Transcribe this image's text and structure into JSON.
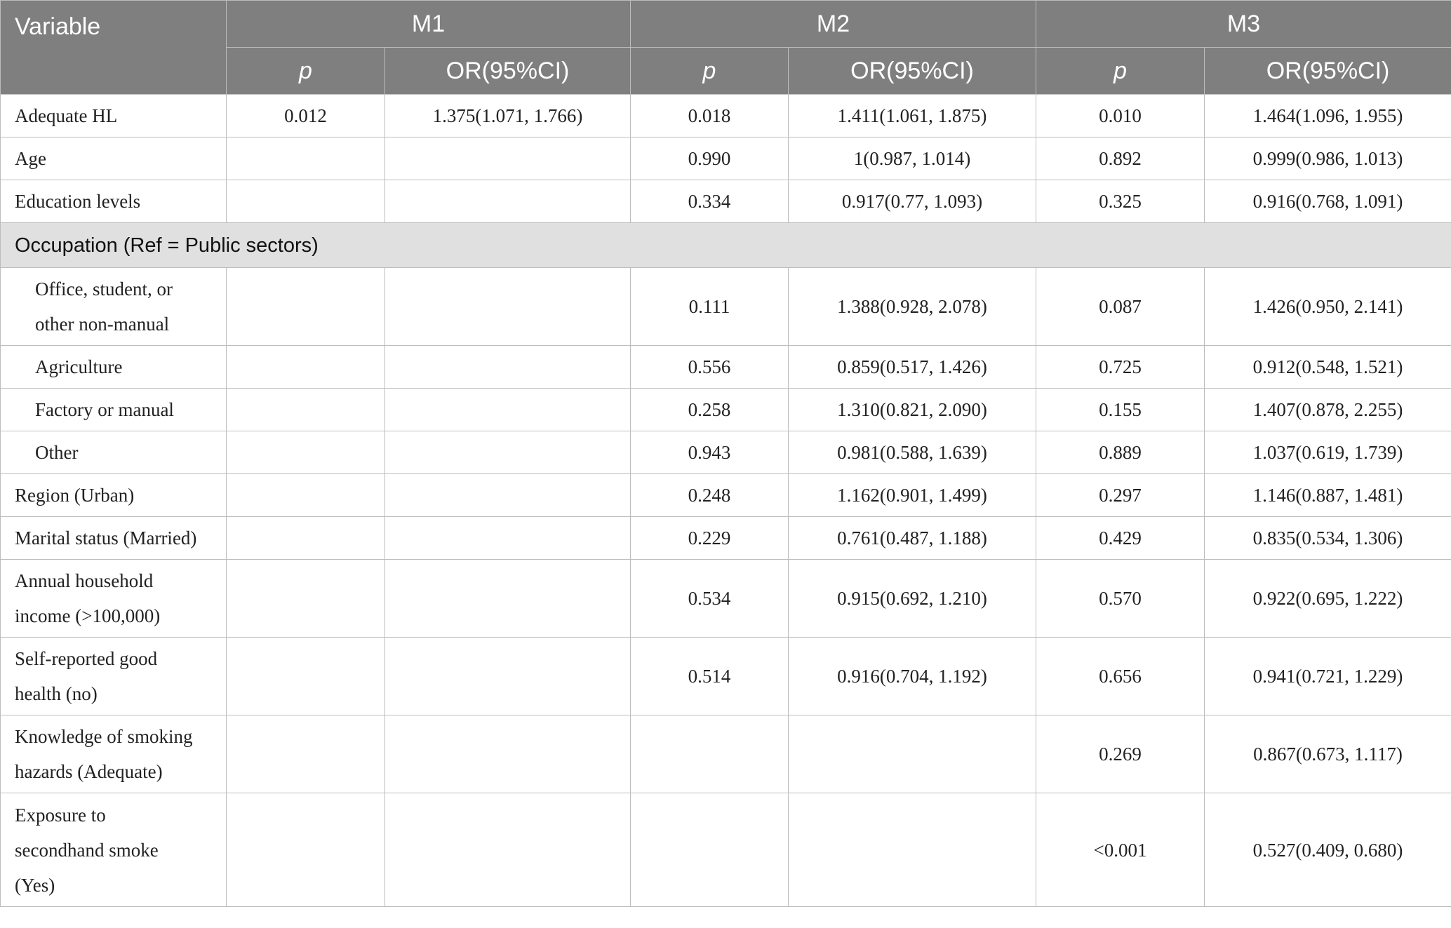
{
  "header": {
    "variable": "Variable",
    "models": [
      "M1",
      "M2",
      "M3"
    ],
    "p": "p",
    "or": "OR(95%CI)"
  },
  "section_label": "Occupation (Ref = Public sectors)",
  "rows_before": [
    {
      "label": "Adequate HL",
      "m1_p": "0.012",
      "m1_or": "1.375(1.071, 1.766)",
      "m2_p": "0.018",
      "m2_or": "1.411(1.061, 1.875)",
      "m3_p": "0.010",
      "m3_or": "1.464(1.096, 1.955)"
    },
    {
      "label": "Age",
      "m1_p": "",
      "m1_or": "",
      "m2_p": "0.990",
      "m2_or": "1(0.987, 1.014)",
      "m3_p": "0.892",
      "m3_or": "0.999(0.986, 1.013)"
    },
    {
      "label": "Education levels",
      "m1_p": "",
      "m1_or": "",
      "m2_p": "0.334",
      "m2_or": "0.917(0.77, 1.093)",
      "m3_p": "0.325",
      "m3_or": "0.916(0.768, 1.091)"
    }
  ],
  "occupation_rows": [
    {
      "label_line1": "Office, student, or",
      "label_line2": "other non-manual",
      "m2_p": "0.111",
      "m2_or": "1.388(0.928, 2.078)",
      "m3_p": "0.087",
      "m3_or": "1.426(0.950, 2.141)"
    },
    {
      "label": "Agriculture",
      "m2_p": "0.556",
      "m2_or": "0.859(0.517, 1.426)",
      "m3_p": "0.725",
      "m3_or": "0.912(0.548, 1.521)"
    },
    {
      "label": "Factory or manual",
      "m2_p": "0.258",
      "m2_or": "1.310(0.821, 2.090)",
      "m3_p": "0.155",
      "m3_or": "1.407(0.878, 2.255)"
    },
    {
      "label": "Other",
      "m2_p": "0.943",
      "m2_or": "0.981(0.588, 1.639)",
      "m3_p": "0.889",
      "m3_or": "1.037(0.619, 1.739)"
    }
  ],
  "rows_after": [
    {
      "label_lines": [
        "Region (Urban)"
      ],
      "m2_p": "0.248",
      "m2_or": "1.162(0.901, 1.499)",
      "m3_p": "0.297",
      "m3_or": "1.146(0.887, 1.481)"
    },
    {
      "label_lines": [
        "Marital status (Married)"
      ],
      "m2_p": "0.229",
      "m2_or": "0.761(0.487, 1.188)",
      "m3_p": "0.429",
      "m3_or": "0.835(0.534, 1.306)"
    },
    {
      "label_lines": [
        "Annual household",
        "income (>100,000)"
      ],
      "m2_p": "0.534",
      "m2_or": "0.915(0.692, 1.210)",
      "m3_p": "0.570",
      "m3_or": "0.922(0.695, 1.222)"
    },
    {
      "label_lines": [
        "Self-reported good",
        "health (no)"
      ],
      "m2_p": "0.514",
      "m2_or": "0.916(0.704, 1.192)",
      "m3_p": "0.656",
      "m3_or": "0.941(0.721, 1.229)"
    },
    {
      "label_lines": [
        "Knowledge of smoking",
        "hazards (Adequate)"
      ],
      "m2_p": "",
      "m2_or": "",
      "m3_p": "0.269",
      "m3_or": "0.867(0.673, 1.117)"
    },
    {
      "label_lines": [
        "Exposure to",
        "secondhand smoke",
        "(Yes)"
      ],
      "m2_p": "",
      "m2_or": "",
      "m3_p": "<0.001",
      "m3_or": "0.527(0.409, 0.680)"
    }
  ]
}
